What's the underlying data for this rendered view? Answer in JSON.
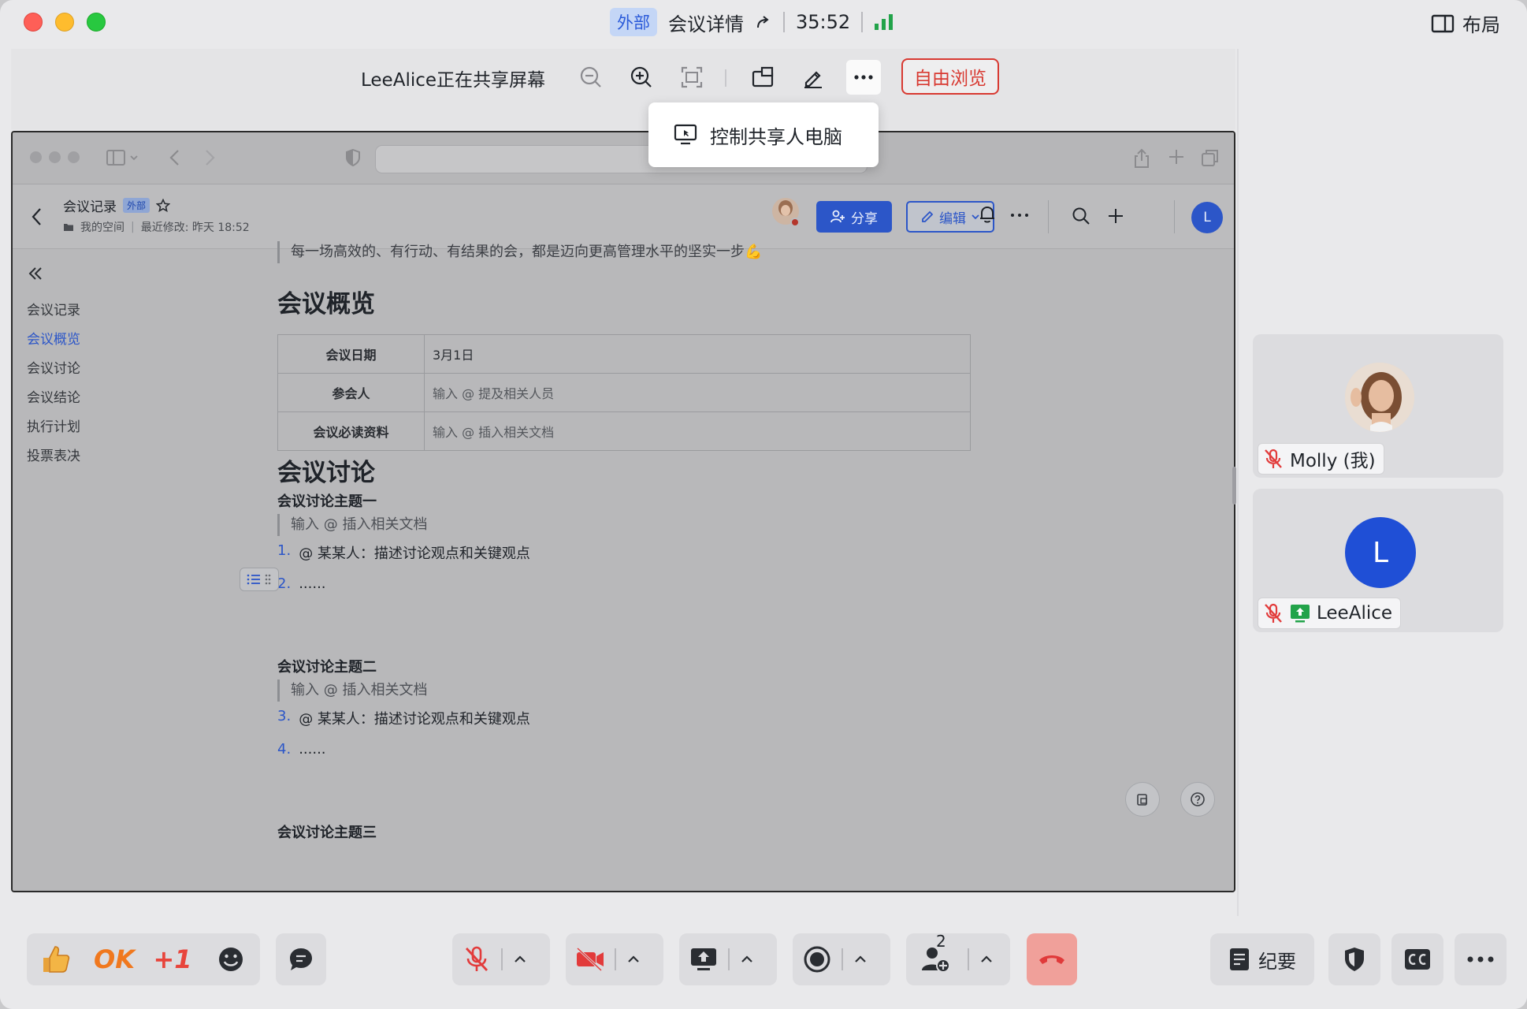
{
  "window": {
    "external_badge": "外部",
    "title": "会议详情",
    "timer": "35:52",
    "layout_label": "布局"
  },
  "share_toolbar": {
    "sharer_text": "LeeAlice正在共享屏幕",
    "free_browse_label": "自由浏览"
  },
  "popup": {
    "control_label": "控制共享人电脑"
  },
  "doc": {
    "title": "会议记录",
    "external_badge": "外部",
    "space": "我的空间",
    "last_modified": "最近修改: 昨天 18:52",
    "share_label": "分享",
    "edit_label": "编辑",
    "avatar_letter": "L",
    "outline": [
      "会议记录",
      "会议概览",
      "会议讨论",
      "会议结论",
      "执行计划",
      "投票表决"
    ],
    "outline_active": "会议概览",
    "top_quote": "每一场高效的、有行动、有结果的会，都是迈向更高管理水平的坚实一步💪",
    "overview_heading": "会议概览",
    "table": [
      {
        "key": "会议日期",
        "value": "3月1日"
      },
      {
        "key": "参会人",
        "value": "输入 @ 提及相关人员"
      },
      {
        "key": "会议必读资料",
        "value": "输入 @ 插入相关文档"
      }
    ],
    "discussion_heading": "会议讨论",
    "topic1": "会议讨论主题一",
    "topic1_quote": "输入 @ 插入相关文档",
    "topic1_items": [
      {
        "num": "1.",
        "text": "@ 某某人：描述讨论观点和关键观点"
      },
      {
        "num": "2.",
        "text": "......"
      }
    ],
    "topic2": "会议讨论主题二",
    "topic2_quote": "输入 @ 插入相关文档",
    "topic2_items": [
      {
        "num": "3.",
        "text": "@ 某某人：描述讨论观点和关键观点"
      },
      {
        "num": "4.",
        "text": "......"
      }
    ],
    "topic3": "会议讨论主题三"
  },
  "participants": [
    {
      "name": "Molly (我)",
      "muted": true
    },
    {
      "name": "LeeAlice",
      "muted": true,
      "sharing": true,
      "letter": "L"
    }
  ],
  "bottom_toolbar": {
    "reaction_ok": "OK",
    "reaction_plus_one": "+1",
    "participant_count": "2",
    "notes_label": "纪要"
  },
  "colors": {
    "accent_blue": "#2c56c8",
    "danger_red": "#d83931",
    "hangup": "#f0a09a"
  }
}
